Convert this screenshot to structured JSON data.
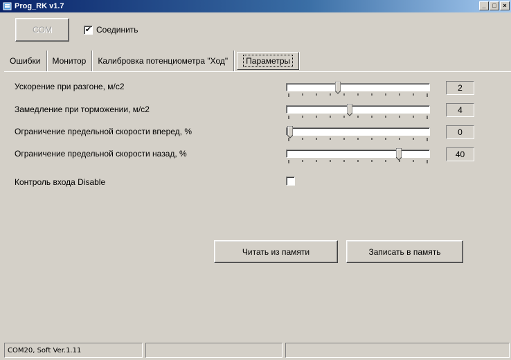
{
  "window": {
    "title": "Prog_RK v1.7",
    "buttons": {
      "minimize": "_",
      "maximize": "□",
      "close": "×"
    }
  },
  "connection": {
    "com_button": "COM",
    "connect_checkbox_checked": true,
    "connect_label": "Соединить"
  },
  "tabs": [
    {
      "label": "Ошибки",
      "active": false
    },
    {
      "label": "Монитор",
      "active": false
    },
    {
      "label": "Калибровка потенциометра \"Ход\"",
      "active": false
    },
    {
      "label": "Параметры",
      "active": true
    }
  ],
  "parameters": [
    {
      "label": "Ускорение при разгоне, м/с2",
      "value": "2",
      "slider_fraction": 0.35
    },
    {
      "label": "Замедление при торможении, м/с2",
      "value": "4",
      "slider_fraction": 0.44
    },
    {
      "label": "Ограничение предельной скорости вперед, %",
      "value": "0",
      "slider_fraction": 0.0
    },
    {
      "label": "Ограничение предельной скорости назад, %",
      "value": "40",
      "slider_fraction": 0.8
    }
  ],
  "disable_control": {
    "label": "Контроль входа Disable",
    "checked": false
  },
  "actions": {
    "read_label": "Читать из памяти",
    "write_label": "Записать в память"
  },
  "status": {
    "cells": [
      "COM20, Soft Ver.1.11",
      "",
      ""
    ]
  },
  "colors": {
    "face": "#d4d0c8",
    "title_start": "#0a246a",
    "title_end": "#a6caf0"
  }
}
